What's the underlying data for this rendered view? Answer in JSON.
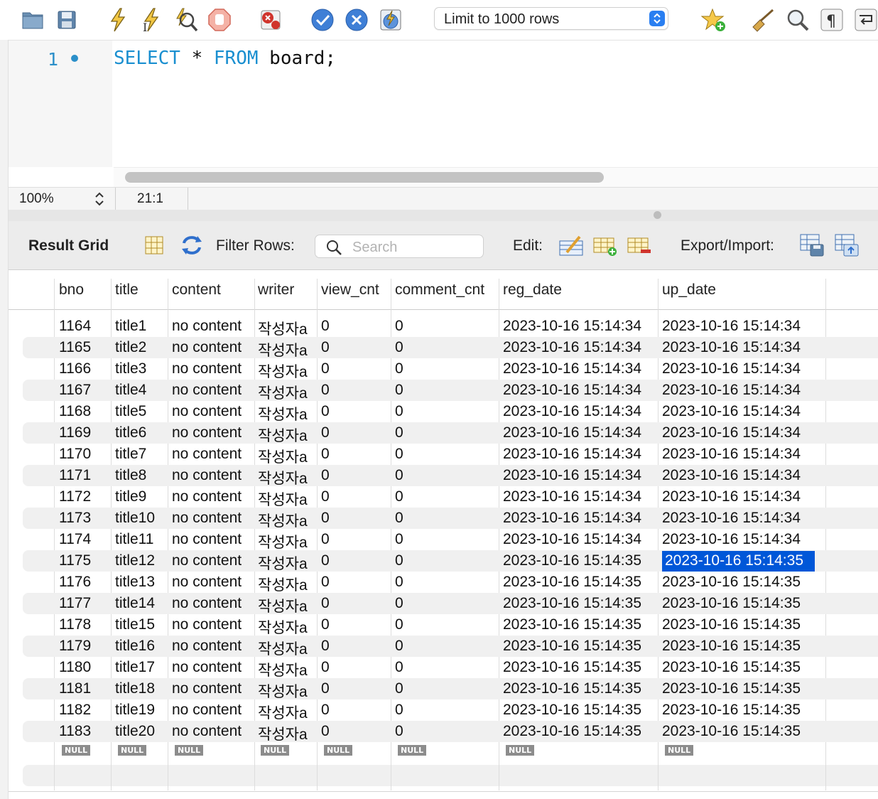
{
  "toolbar": {
    "limit_select_label": "Limit to 1000 rows",
    "icons": [
      "open-folder-icon",
      "save-icon",
      "execute-icon",
      "execute-current-icon",
      "explain-icon",
      "stop-icon",
      "toggle-error-icon",
      "commit-icon",
      "rollback-icon",
      "autocommit-icon",
      "add-snippet-icon",
      "beautify-icon",
      "find-icon",
      "invisibles-icon",
      "wrap-icon"
    ]
  },
  "editor": {
    "line_number": "1",
    "keyword1": "SELECT",
    "op": " * ",
    "keyword2": "FROM",
    "rest": " board;"
  },
  "statusbar": {
    "zoom": "100%",
    "cursor_position": "21:1"
  },
  "result_toolbar": {
    "result_grid_label": "Result Grid",
    "filter_label": "Filter Rows:",
    "search_placeholder": "Search",
    "edit_label": "Edit:",
    "export_label": "Export/Import:"
  },
  "grid": {
    "columns": [
      "bno",
      "title",
      "content",
      "writer",
      "view_cnt",
      "comment_cnt",
      "reg_date",
      "up_date"
    ],
    "rows": [
      [
        "1164",
        "title1",
        "no content",
        "작성자a",
        "0",
        "0",
        "2023-10-16 15:14:34",
        "2023-10-16 15:14:34"
      ],
      [
        "1165",
        "title2",
        "no content",
        "작성자a",
        "0",
        "0",
        "2023-10-16 15:14:34",
        "2023-10-16 15:14:34"
      ],
      [
        "1166",
        "title3",
        "no content",
        "작성자a",
        "0",
        "0",
        "2023-10-16 15:14:34",
        "2023-10-16 15:14:34"
      ],
      [
        "1167",
        "title4",
        "no content",
        "작성자a",
        "0",
        "0",
        "2023-10-16 15:14:34",
        "2023-10-16 15:14:34"
      ],
      [
        "1168",
        "title5",
        "no content",
        "작성자a",
        "0",
        "0",
        "2023-10-16 15:14:34",
        "2023-10-16 15:14:34"
      ],
      [
        "1169",
        "title6",
        "no content",
        "작성자a",
        "0",
        "0",
        "2023-10-16 15:14:34",
        "2023-10-16 15:14:34"
      ],
      [
        "1170",
        "title7",
        "no content",
        "작성자a",
        "0",
        "0",
        "2023-10-16 15:14:34",
        "2023-10-16 15:14:34"
      ],
      [
        "1171",
        "title8",
        "no content",
        "작성자a",
        "0",
        "0",
        "2023-10-16 15:14:34",
        "2023-10-16 15:14:34"
      ],
      [
        "1172",
        "title9",
        "no content",
        "작성자a",
        "0",
        "0",
        "2023-10-16 15:14:34",
        "2023-10-16 15:14:34"
      ],
      [
        "1173",
        "title10",
        "no content",
        "작성자a",
        "0",
        "0",
        "2023-10-16 15:14:34",
        "2023-10-16 15:14:34"
      ],
      [
        "1174",
        "title11",
        "no content",
        "작성자a",
        "0",
        "0",
        "2023-10-16 15:14:34",
        "2023-10-16 15:14:34"
      ],
      [
        "1175",
        "title12",
        "no content",
        "작성자a",
        "0",
        "0",
        "2023-10-16 15:14:35",
        "2023-10-16 15:14:35"
      ],
      [
        "1176",
        "title13",
        "no content",
        "작성자a",
        "0",
        "0",
        "2023-10-16 15:14:35",
        "2023-10-16 15:14:35"
      ],
      [
        "1177",
        "title14",
        "no content",
        "작성자a",
        "0",
        "0",
        "2023-10-16 15:14:35",
        "2023-10-16 15:14:35"
      ],
      [
        "1178",
        "title15",
        "no content",
        "작성자a",
        "0",
        "0",
        "2023-10-16 15:14:35",
        "2023-10-16 15:14:35"
      ],
      [
        "1179",
        "title16",
        "no content",
        "작성자a",
        "0",
        "0",
        "2023-10-16 15:14:35",
        "2023-10-16 15:14:35"
      ],
      [
        "1180",
        "title17",
        "no content",
        "작성자a",
        "0",
        "0",
        "2023-10-16 15:14:35",
        "2023-10-16 15:14:35"
      ],
      [
        "1181",
        "title18",
        "no content",
        "작성자a",
        "0",
        "0",
        "2023-10-16 15:14:35",
        "2023-10-16 15:14:35"
      ],
      [
        "1182",
        "title19",
        "no content",
        "작성자a",
        "0",
        "0",
        "2023-10-16 15:14:35",
        "2023-10-16 15:14:35"
      ],
      [
        "1183",
        "title20",
        "no content",
        "작성자a",
        "0",
        "0",
        "2023-10-16 15:14:35",
        "2023-10-16 15:14:35"
      ]
    ],
    "selected_cell": {
      "row": 11,
      "col": 7
    },
    "null_label": "NULL"
  },
  "colors": {
    "keyword": "#1a8fd0",
    "selection": "#0057d8",
    "accent": "#2a7ff1"
  }
}
